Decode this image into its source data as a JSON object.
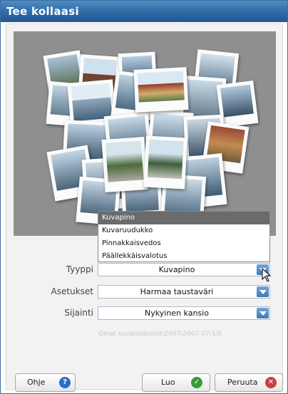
{
  "window": {
    "title": "Tee kollaasi"
  },
  "form": {
    "type_label": "Tyyppi",
    "type_value": "Kuvapino",
    "settings_label": "Asetukset",
    "settings_value": "Harmaa taustaväri",
    "location_label": "Sijainti",
    "location_value": "Nykyinen kansio",
    "path_text": "Omat kuvatiedostot\\2007\\2007-07-13\\"
  },
  "type_dropdown": {
    "options": [
      "Kuvapino",
      "Kuvaruudukko",
      "Pinnakkaisvedos",
      "Päällekkäisvalotus"
    ],
    "selected_index": 0
  },
  "buttons": {
    "help": "Ohje",
    "create": "Luo",
    "cancel": "Peruuta"
  },
  "icons": {
    "help": "help-question-icon",
    "create": "check-icon",
    "cancel": "close-x-icon"
  },
  "colors": {
    "titlebar": "#2f6aa7",
    "preview_bg": "#8f8f8f",
    "dropdown_selected": "#6b6b6b",
    "combo_arrow": "#3c79b8",
    "help_icon": "#2f6cc7",
    "check_icon": "#3a9a37",
    "cancel_icon": "#c94040"
  }
}
